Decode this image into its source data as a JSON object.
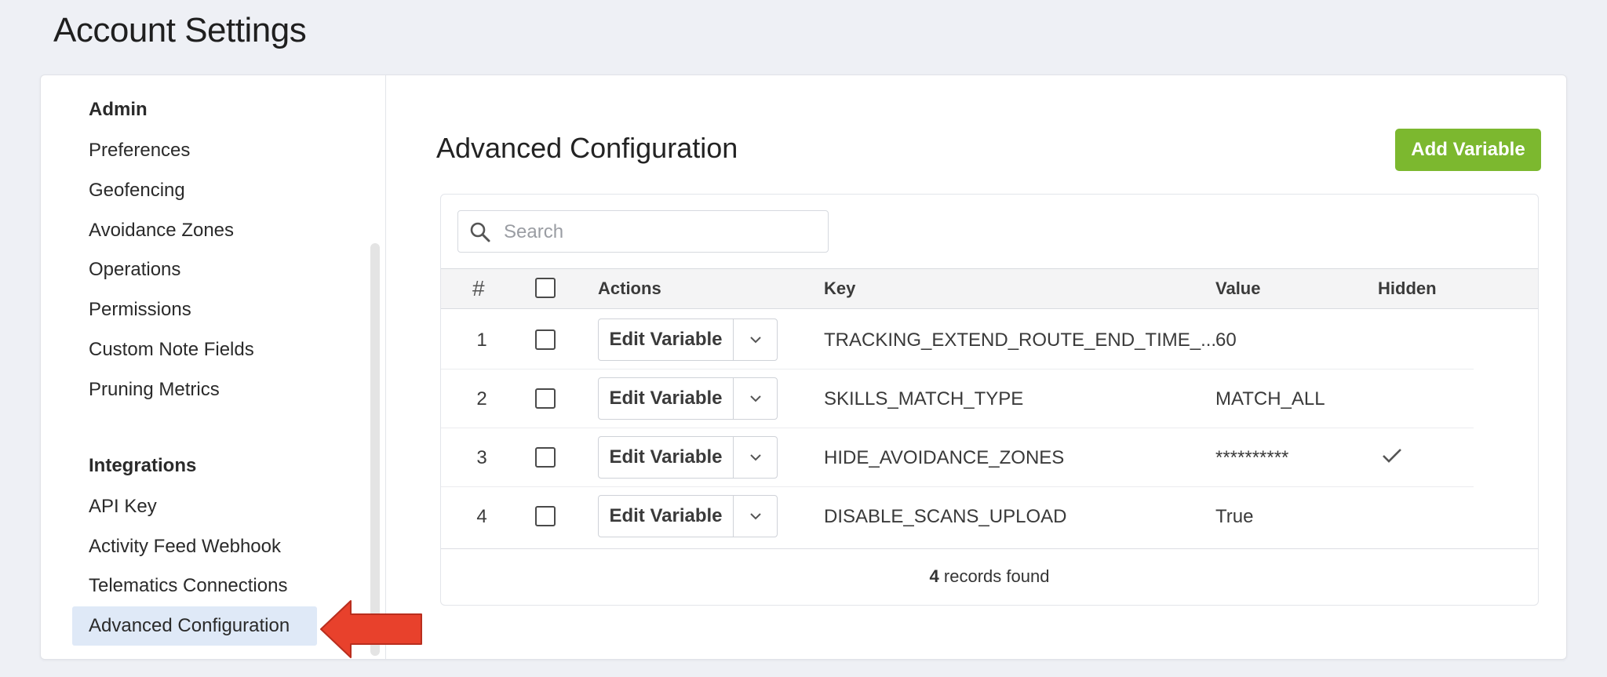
{
  "page": {
    "title": "Account Settings"
  },
  "sidebar": {
    "sections": [
      {
        "title": "Admin",
        "items": [
          "Preferences",
          "Geofencing",
          "Avoidance Zones",
          "Operations",
          "Permissions",
          "Custom Note Fields",
          "Pruning Metrics"
        ]
      },
      {
        "title": "Integrations",
        "items": [
          "API Key",
          "Activity Feed Webhook",
          "Telematics Connections",
          "Advanced Configuration"
        ]
      }
    ],
    "active_item": "Advanced Configuration"
  },
  "main": {
    "title": "Advanced Configuration",
    "add_button_label": "Add Variable",
    "search": {
      "placeholder": "Search",
      "value": ""
    },
    "table": {
      "headers": {
        "num": "#",
        "actions": "Actions",
        "key": "Key",
        "value": "Value",
        "hidden": "Hidden"
      },
      "rows": [
        {
          "num": "1",
          "action": "Edit Variable",
          "key": "TRACKING_EXTEND_ROUTE_END_TIME_...",
          "value": "60",
          "hidden": false
        },
        {
          "num": "2",
          "action": "Edit Variable",
          "key": "SKILLS_MATCH_TYPE",
          "value": "MATCH_ALL",
          "hidden": false
        },
        {
          "num": "3",
          "action": "Edit Variable",
          "key": "HIDE_AVOIDANCE_ZONES",
          "value": "**********",
          "hidden": true
        },
        {
          "num": "4",
          "action": "Edit Variable",
          "key": "DISABLE_SCANS_UPLOAD",
          "value": "True",
          "hidden": false
        }
      ]
    },
    "footer": {
      "count": "4",
      "label": "records found"
    }
  },
  "colors": {
    "accent_green": "#7cb82f",
    "active_item_bg": "#dfe9f7",
    "arrow_red": "#e8412c",
    "page_bg": "#eef0f5"
  }
}
